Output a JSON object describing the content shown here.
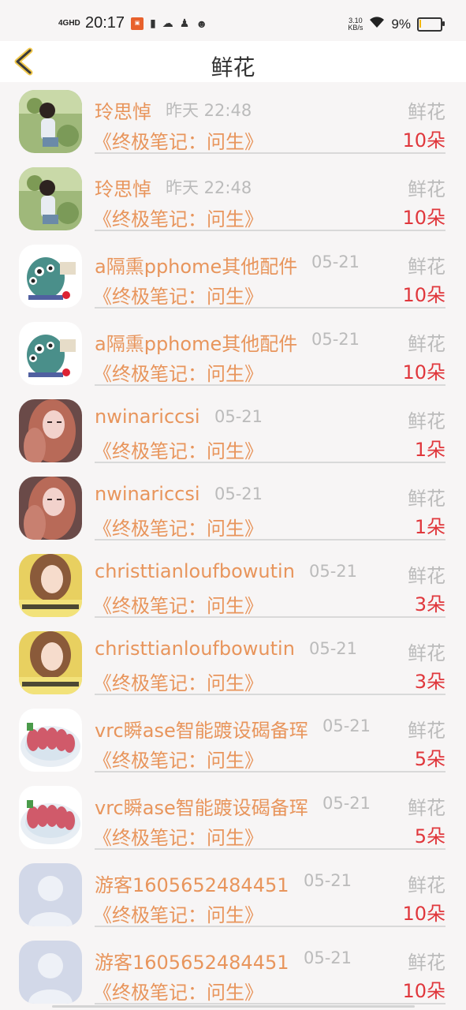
{
  "status_bar": {
    "network": "4GHD",
    "time": "20:17",
    "speed_value": "3.10",
    "speed_unit": "KB/s",
    "battery": "9%",
    "battery_level": 0.09
  },
  "header": {
    "title": "鲜花"
  },
  "items": [
    {
      "name": "玲思悼",
      "date": "昨天 22:48",
      "gift": "鲜花",
      "book": "《终极笔记：问生》",
      "count": "10朵",
      "avatar": "photo-girl-garden"
    },
    {
      "name": "玲思悼",
      "date": "昨天 22:48",
      "gift": "鲜花",
      "book": "《终极笔记：问生》",
      "count": "10朵",
      "avatar": "photo-girl-garden"
    },
    {
      "name": "a隔熏pphome其他配件",
      "date": "05-21",
      "gift": "鲜花",
      "book": "《终极笔记：问生》",
      "count": "10朵",
      "avatar": "cartoon-monster"
    },
    {
      "name": "a隔熏pphome其他配件",
      "date": "05-21",
      "gift": "鲜花",
      "book": "《终极笔记：问生》",
      "count": "10朵",
      "avatar": "cartoon-monster"
    },
    {
      "name": "nwinariccsi",
      "date": "05-21",
      "gift": "鲜花",
      "book": "《终极笔记：问生》",
      "count": "1朵",
      "avatar": "photo-girl-pink"
    },
    {
      "name": "nwinariccsi",
      "date": "05-21",
      "gift": "鲜花",
      "book": "《终极笔记：问生》",
      "count": "1朵",
      "avatar": "photo-girl-pink"
    },
    {
      "name": "christtianloufbowutin",
      "date": "05-21",
      "gift": "鲜花",
      "book": "《终极笔记：问生》",
      "count": "3朵",
      "avatar": "photo-girl-yellow"
    },
    {
      "name": "christtianloufbowutin",
      "date": "05-21",
      "gift": "鲜花",
      "book": "《终极笔记：问生》",
      "count": "3朵",
      "avatar": "photo-girl-yellow"
    },
    {
      "name": "vrc瞬ase智能踱设碣备珲",
      "date": "05-21",
      "gift": "鲜花",
      "book": "《终极笔记：问生》",
      "count": "5朵",
      "avatar": "photo-sashimi"
    },
    {
      "name": "vrc瞬ase智能踱设碣备珲",
      "date": "05-21",
      "gift": "鲜花",
      "book": "《终极笔记：问生》",
      "count": "5朵",
      "avatar": "photo-sashimi"
    },
    {
      "name": "游客1605652484451",
      "date": "05-21",
      "gift": "鲜花",
      "book": "《终极笔记：问生》",
      "count": "10朵",
      "avatar": "default-user"
    },
    {
      "name": "游客1605652484451",
      "date": "05-21",
      "gift": "鲜花",
      "book": "《终极笔记：问生》",
      "count": "10朵",
      "avatar": "default-user"
    }
  ]
}
